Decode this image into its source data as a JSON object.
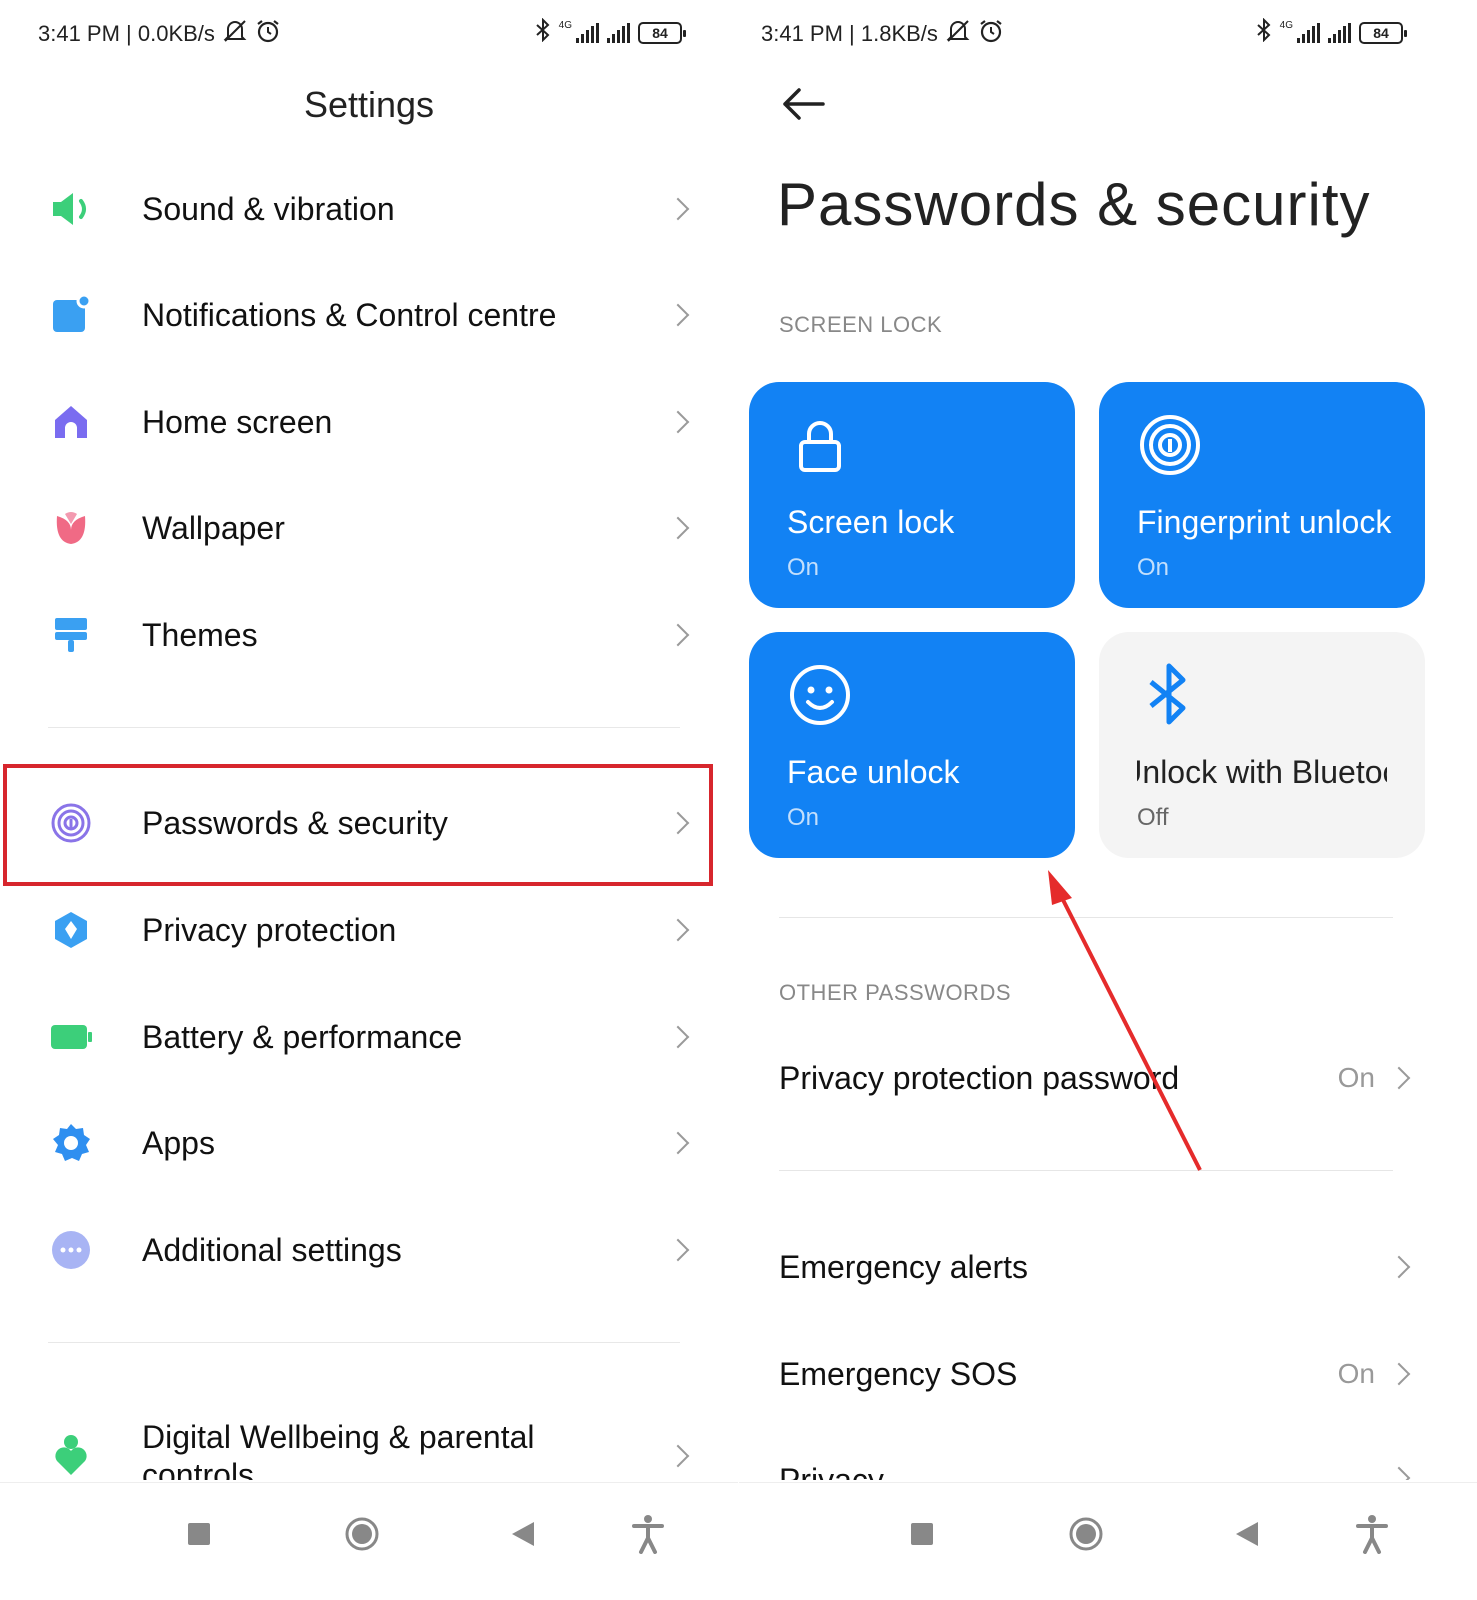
{
  "left": {
    "status": {
      "time": "3:41 PM | 0.0KB/s",
      "network": "4G",
      "battery": "84"
    },
    "title": "Settings",
    "items": [
      {
        "label": "Sound & vibration",
        "icon": "speaker-icon",
        "color": "#3ccf7a"
      },
      {
        "label": "Notifications & Control centre",
        "icon": "notification-icon",
        "color": "#3aa0f2"
      },
      {
        "label": "Home screen",
        "icon": "home-icon",
        "color": "#7a6cf0"
      },
      {
        "label": "Wallpaper",
        "icon": "flower-icon",
        "color": "#f06a85"
      },
      {
        "label": "Themes",
        "icon": "brush-icon",
        "color": "#3aa0f2"
      },
      {
        "label": "Passwords & security",
        "icon": "fingerprint-icon",
        "color": "#8a74e8"
      },
      {
        "label": "Privacy protection",
        "icon": "privacy-icon",
        "color": "#3aa0f2"
      },
      {
        "label": "Battery & performance",
        "icon": "battery-icon",
        "color": "#3ccf7a"
      },
      {
        "label": "Apps",
        "icon": "gear-icon",
        "color": "#2f8ff0"
      },
      {
        "label": "Additional settings",
        "icon": "more-icon",
        "color": "#a8b4f4"
      },
      {
        "label": "Digital Wellbeing & parental controls",
        "icon": "wellbeing-icon",
        "color": "#3ccf7a"
      }
    ]
  },
  "right": {
    "status": {
      "time": "3:41 PM | 1.8KB/s",
      "network": "4G",
      "battery": "84"
    },
    "title": "Passwords & security",
    "screen_lock_label": "SCREEN LOCK",
    "tiles": [
      {
        "title": "Screen lock",
        "status": "On"
      },
      {
        "title": "Fingerprint unlock",
        "status": "On"
      },
      {
        "title": "Face unlock",
        "status": "On"
      },
      {
        "title": "Unlock with Bluetooth",
        "status": "Off"
      }
    ],
    "other_passwords_label": "OTHER PASSWORDS",
    "rows": [
      {
        "label": "Privacy protection password",
        "value": "On"
      },
      {
        "label": "Emergency alerts",
        "value": ""
      },
      {
        "label": "Emergency SOS",
        "value": "On"
      },
      {
        "label": "Privacy",
        "value": ""
      }
    ]
  },
  "colors": {
    "accent": "#1282f4",
    "highlight": "#d7262d"
  }
}
